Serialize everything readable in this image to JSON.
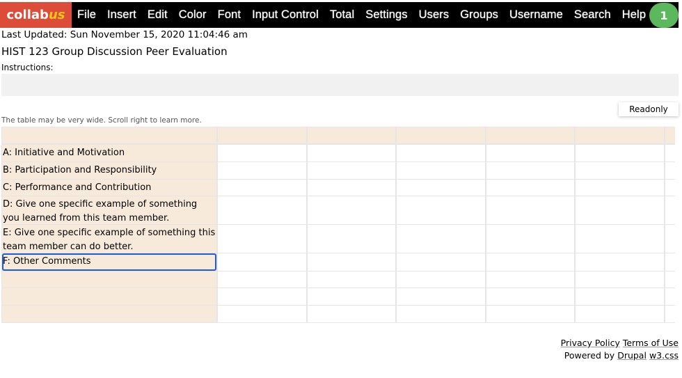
{
  "nav": {
    "logo_main": "collab",
    "logo_accent": "us",
    "items": [
      "File",
      "Insert",
      "Edit",
      "Color",
      "Font",
      "Input Control",
      "Total",
      "Settings",
      "Users",
      "Groups",
      "Username",
      "Search",
      "Help"
    ],
    "user_count": "1"
  },
  "last_updated": "Last Updated: Sun November 15, 2020 11:04:46 am",
  "title": "HIST 123 Group Discussion Peer Evaluation",
  "instructions_label": "Instructions:",
  "readonly_label": "Readonly",
  "table_note": "The table may be very wide. Scroll right to learn more.",
  "table": {
    "rows": [
      "A: Initiative and Motivation",
      "B: Participation and Responsibility",
      "C: Performance and Contribution",
      "D: Give one specific example of something you learned from this team member.",
      "E: Give one specific example of something this team member can do better.",
      "F: Other Comments",
      "",
      "",
      ""
    ]
  },
  "footer": {
    "privacy": "Privacy Policy",
    "terms": "Terms of Use",
    "powered": "Powered by",
    "drupal": "Drupal",
    "w3": "w3.css"
  },
  "colors": {
    "logo_bg": "#dd4b39",
    "badge": "#5cb85c",
    "label_cell": "#f8eadb",
    "selection": "#1e5bd6"
  }
}
